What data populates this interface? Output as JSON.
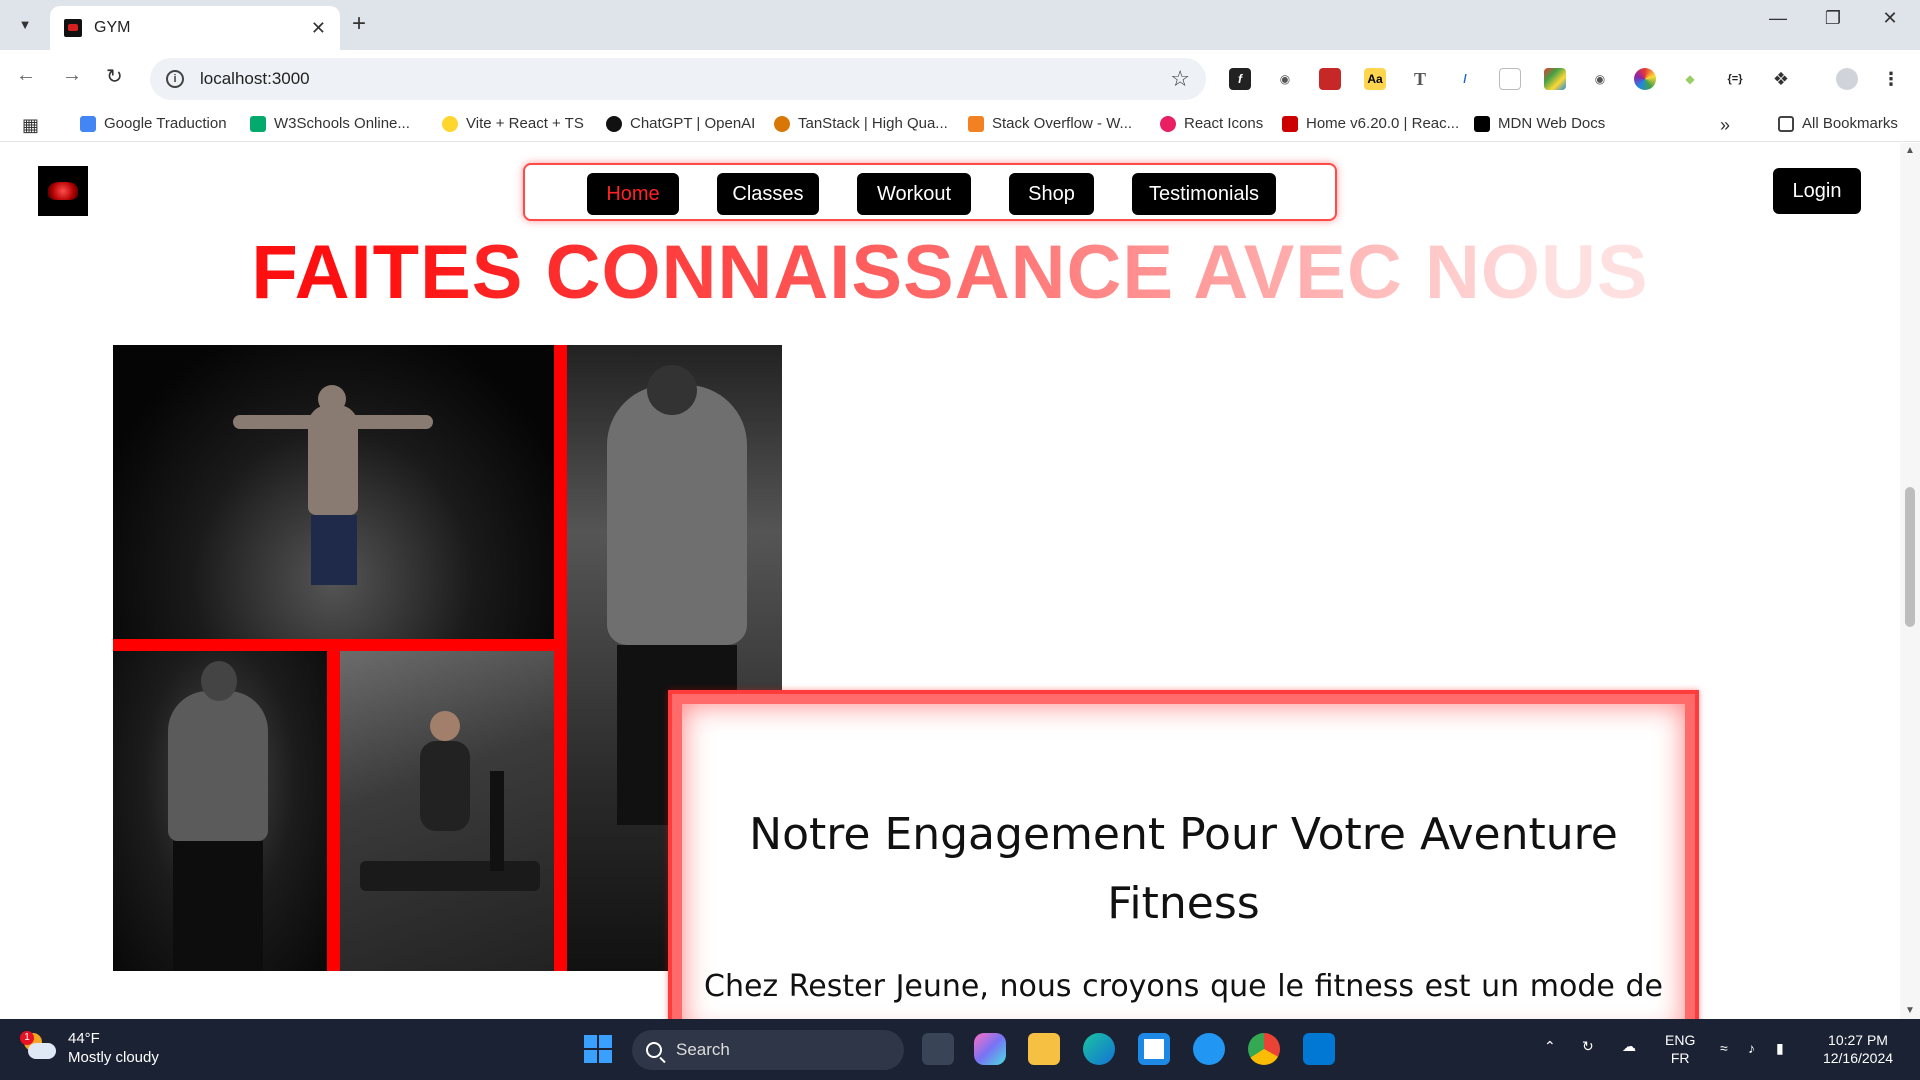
{
  "browser": {
    "tab_title": "GYM",
    "url": "localhost:3000",
    "bookmarks": [
      {
        "label": "Google Traduction",
        "color": "#4285f4"
      },
      {
        "label": "W3Schools Online...",
        "color": "#04aa6d"
      },
      {
        "label": "Vite + React + TS",
        "color": "#ffd62e"
      },
      {
        "label": "ChatGPT | OpenAI",
        "color": "#111111"
      },
      {
        "label": "TanStack | High Qua...",
        "color": "#d97706"
      },
      {
        "label": "Stack Overflow - W...",
        "color": "#f48024"
      },
      {
        "label": "React Icons",
        "color": "#e91e63"
      },
      {
        "label": "Home v6.20.0 | Reac...",
        "color": "#cc0000"
      },
      {
        "label": "MDN Web Docs",
        "color": "#000000"
      }
    ],
    "all_bookmarks": "All Bookmarks"
  },
  "site": {
    "nav": [
      {
        "label": "Home",
        "active": true
      },
      {
        "label": "Classes",
        "active": false
      },
      {
        "label": "Workout",
        "active": false
      },
      {
        "label": "Shop",
        "active": false
      },
      {
        "label": "Testimonials",
        "active": false
      }
    ],
    "login": "Login",
    "hero_title": "FAITES CONNAISSANCE AVEC NOUS",
    "card": {
      "title": "Notre Engagement Pour Votre Aventure Fitness",
      "text": "Chez Rester Jeune, nous croyons que le fitness est un mode de vie accessible à tous. Notre salle moderne offre une variété d'équipements et"
    },
    "accent_color": "#ff0000"
  },
  "taskbar": {
    "weather_temp": "44°F",
    "weather_desc": "Mostly cloudy",
    "weather_badge": "1",
    "search_label": "Search",
    "lang_top": "ENG",
    "lang_bottom": "FR",
    "time": "10:27 PM",
    "date": "12/16/2024"
  }
}
